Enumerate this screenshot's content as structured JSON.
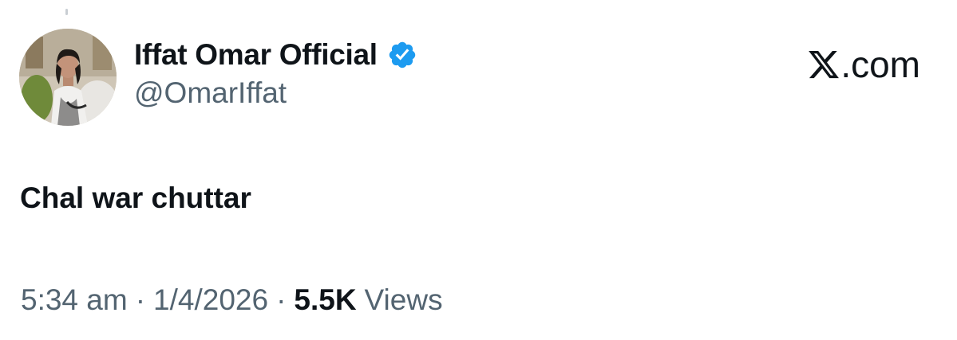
{
  "author": {
    "display_name": "Iffat Omar Official",
    "handle": "@OmarIffat",
    "verified": true,
    "avatar_icon": "profile-photo"
  },
  "brand": {
    "text": ".com",
    "logo_icon": "x-logo-icon"
  },
  "tweet": {
    "text": "Chal war chuttar"
  },
  "meta": {
    "time": "5:34 am",
    "separator": "·",
    "date": "1/4/2026",
    "views_count": "5.5K",
    "views_label": "Views"
  },
  "colors": {
    "text_primary": "#0f1419",
    "text_secondary": "#536471",
    "verified_blue": "#1d9bf0",
    "background": "#ffffff"
  }
}
